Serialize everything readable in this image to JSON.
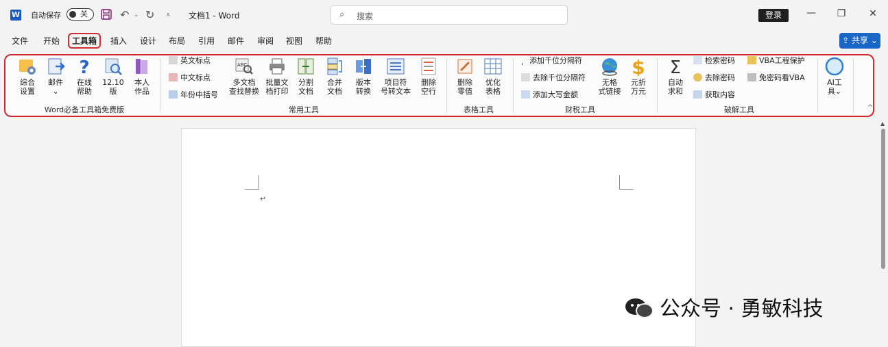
{
  "titlebar": {
    "autosave_label": "自动保存",
    "toggle_state": "关",
    "doc_title": "文档1  -  Word",
    "search_placeholder": "搜索",
    "login_label": "登录"
  },
  "tabs": [
    "文件",
    "开始",
    "工具箱",
    "插入",
    "设计",
    "布局",
    "引用",
    "邮件",
    "审阅",
    "视图",
    "帮助"
  ],
  "active_tab": "工具箱",
  "share_label": "共享",
  "ribbon": {
    "group1": {
      "label": "Word必备工具箱免费版",
      "buttons": [
        {
          "l1": "综合",
          "l2": "设置"
        },
        {
          "l1": "邮件",
          "l2": "⌄"
        },
        {
          "l1": "在线",
          "l2": "帮助"
        },
        {
          "l1": "12.10",
          "l2": "版"
        },
        {
          "l1": "本人",
          "l2": "作品"
        }
      ]
    },
    "group2": {
      "label": "常用工具",
      "small": [
        "英文标点",
        "中文标点",
        "年份中括号"
      ],
      "buttons": [
        {
          "l1": "多文档",
          "l2": "查找替换"
        },
        {
          "l1": "批量文",
          "l2": "档打印"
        },
        {
          "l1": "分割",
          "l2": "文档"
        },
        {
          "l1": "合并",
          "l2": "文档"
        },
        {
          "l1": "版本",
          "l2": "转换"
        },
        {
          "l1": "项目符",
          "l2": "号转文本"
        },
        {
          "l1": "删除",
          "l2": "空行"
        }
      ]
    },
    "group3": {
      "label": "表格工具",
      "buttons": [
        {
          "l1": "删除",
          "l2": "零值"
        },
        {
          "l1": "优化",
          "l2": "表格"
        }
      ]
    },
    "group4": {
      "label": "财税工具",
      "small": [
        "添加千位分隔符",
        "去除千位分隔符",
        "添加大写金额"
      ],
      "buttons": [
        {
          "l1": "无格",
          "l2": "式链接"
        },
        {
          "l1": "元折",
          "l2": "万元"
        }
      ]
    },
    "group5": {
      "label": "破解工具",
      "buttons": [
        {
          "l1": "自动",
          "l2": "求和"
        }
      ],
      "small": [
        "检索密码",
        "去除密码",
        "获取内容",
        "VBA工程保护",
        "免密码看VBA"
      ]
    },
    "group6": {
      "buttons": [
        {
          "l1": "AI工",
          "l2": "具⌄"
        }
      ]
    }
  },
  "document": {
    "paragraph_mark": "↵"
  },
  "watermark": "公众号 · 勇敏科技",
  "colors": {
    "accent_red": "#d0292e",
    "word_blue": "#185abd",
    "share_blue": "#1a66c6"
  }
}
